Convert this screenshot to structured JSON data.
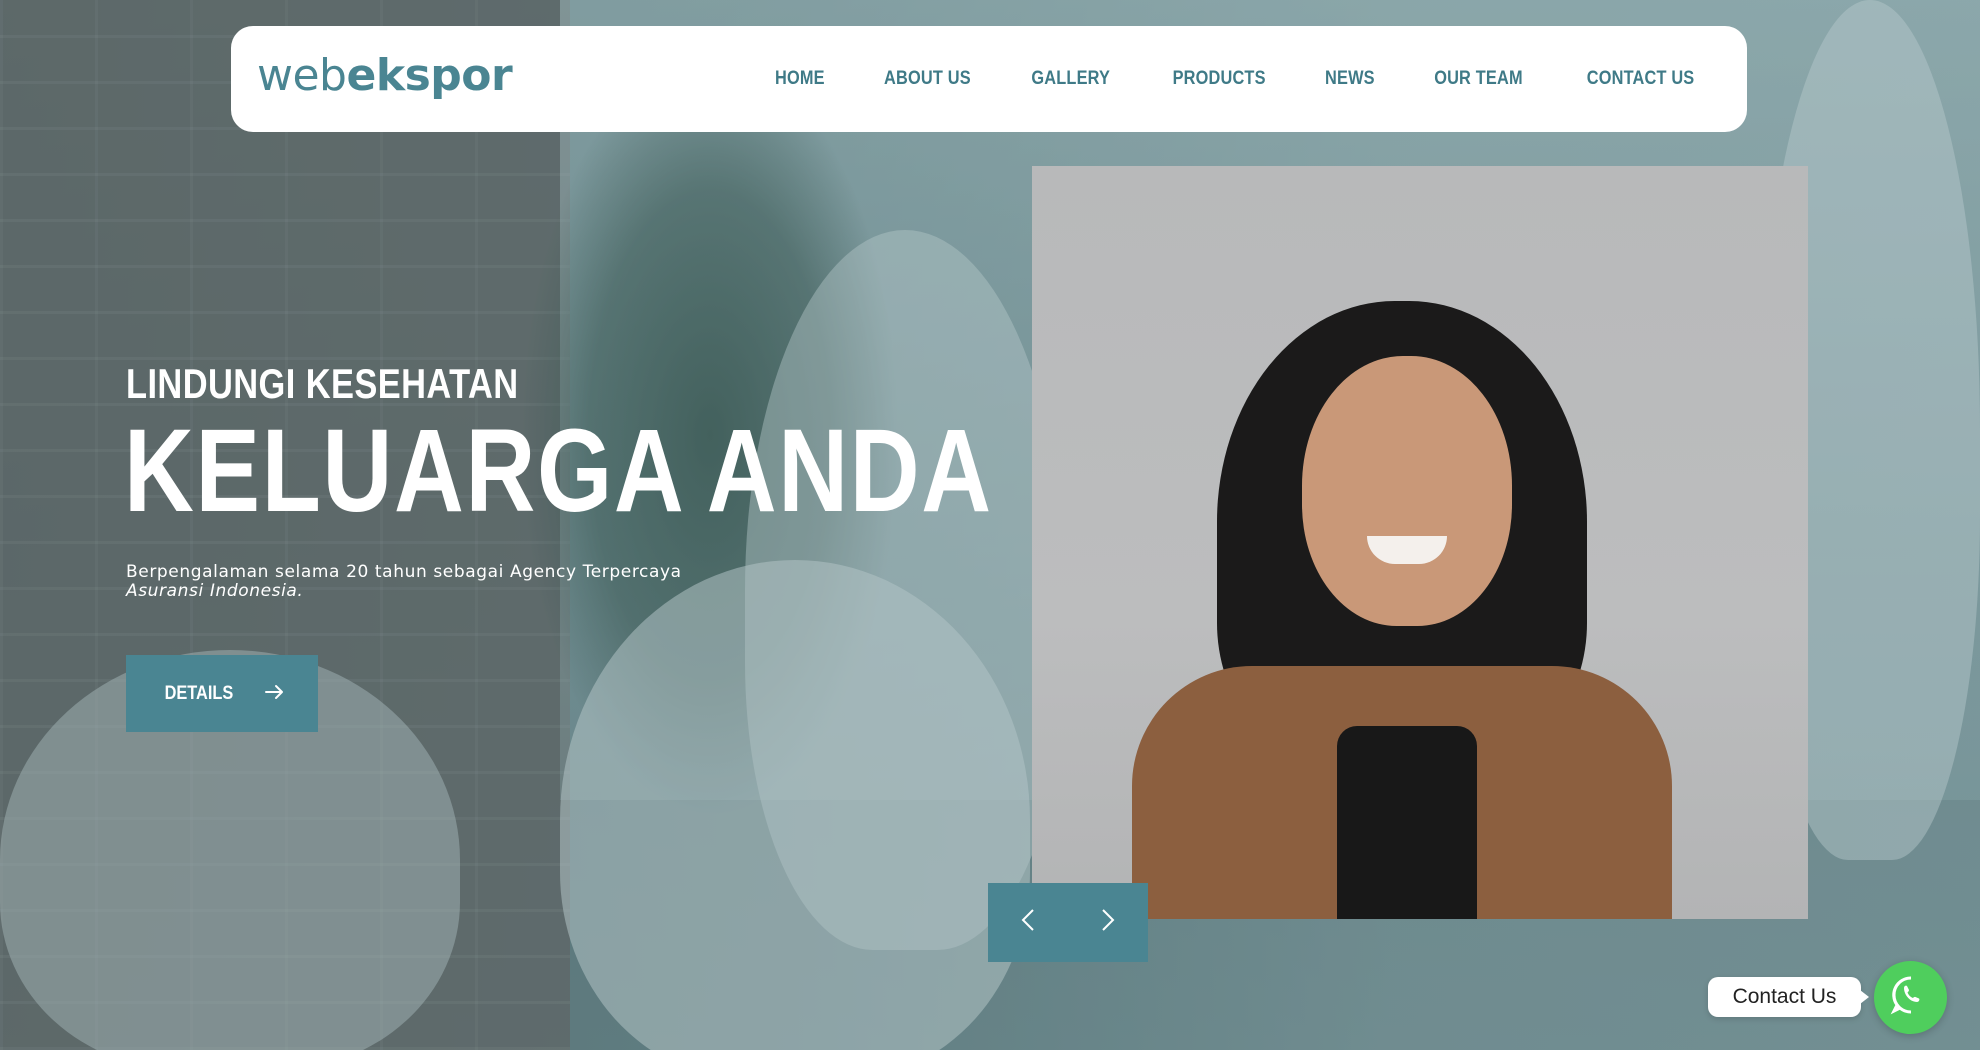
{
  "brand": {
    "logo_light": "web",
    "logo_bold": "ekspor",
    "accent": "#4a8592"
  },
  "nav": {
    "items": [
      {
        "label": "HOME"
      },
      {
        "label": "ABOUT US"
      },
      {
        "label": "GALLERY"
      },
      {
        "label": "PRODUCTS"
      },
      {
        "label": "NEWS"
      },
      {
        "label": "OUR TEAM"
      },
      {
        "label": "CONTACT US"
      }
    ]
  },
  "hero": {
    "kicker": "LINDUNGI KESEHATAN",
    "title": "KELUARGA ANDA",
    "description": "Berpengalaman selama 20 tahun sebagai Agency Terpercaya",
    "description_italic": "Asuransi Indonesia.",
    "button_label": "DETAILS",
    "button_icon": "arrow-right-icon"
  },
  "slider": {
    "prev_icon": "chevron-left-icon",
    "next_icon": "chevron-right-icon"
  },
  "floating_contact": {
    "label": "Contact Us",
    "icon": "whatsapp-icon",
    "color": "#4fce5d"
  }
}
